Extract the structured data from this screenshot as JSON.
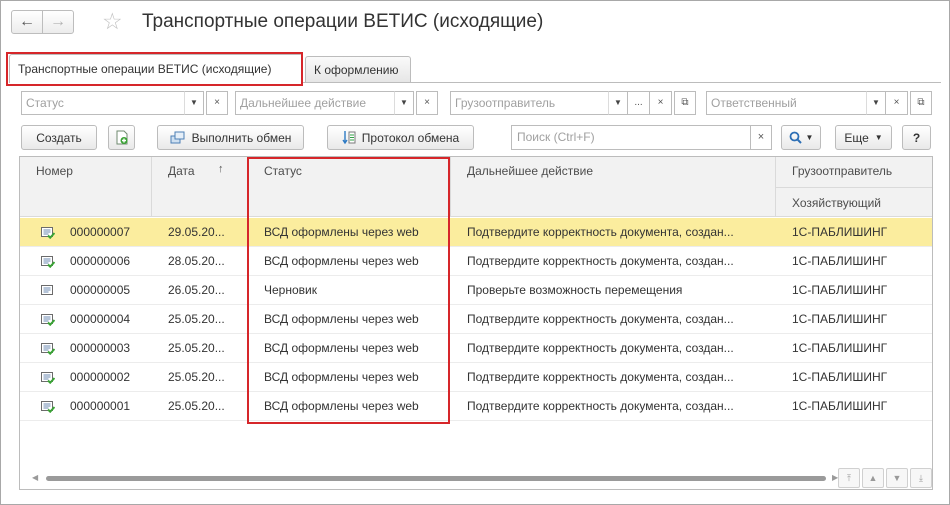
{
  "window": {
    "title": "Транспортные операции ВЕТИС (исходящие)",
    "back_icon": "arrow-left-icon",
    "forward_icon": "arrow-right-icon",
    "favorite_icon": "star-icon"
  },
  "tabs": [
    {
      "label": "Транспортные операции ВЕТИС (исходящие)",
      "active": true
    },
    {
      "label": "К оформлению",
      "active": false
    }
  ],
  "filters": {
    "status": {
      "placeholder": "Статус"
    },
    "next_action": {
      "placeholder": "Дальнейшее действие"
    },
    "shipper": {
      "placeholder": "Грузоотправитель"
    },
    "responsible": {
      "placeholder": "Ответственный"
    },
    "clear_glyph": "×",
    "dropdown_glyph": "▼",
    "select_glyph": "..."
  },
  "toolbar": {
    "create_label": "Создать",
    "exchange_label": "Выполнить обмен",
    "protocol_label": "Протокол обмена",
    "search_placeholder": "Поиск (Ctrl+F)",
    "more_label": "Еще",
    "help_label": "?"
  },
  "table": {
    "columns": {
      "number": "Номер",
      "date": "Дата",
      "status": "Статус",
      "next_action": "Дальнейшее действие",
      "shipper": "Грузоотправитель",
      "entity": "Хозяйствующий"
    },
    "sort_glyph": "↑",
    "rows": [
      {
        "number": "000000007",
        "date": "29.05.20...",
        "status": "ВСД оформлены через web",
        "next_action": "Подтвердите корректность документа, создан...",
        "shipper": "1С-ПАБЛИШИНГ",
        "icon": "document-posted-icon",
        "selected": true
      },
      {
        "number": "000000006",
        "date": "28.05.20...",
        "status": "ВСД оформлены через web",
        "next_action": "Подтвердите корректность документа, создан...",
        "shipper": "1С-ПАБЛИШИНГ",
        "icon": "document-posted-icon",
        "selected": false
      },
      {
        "number": "000000005",
        "date": "26.05.20...",
        "status": "Черновик",
        "next_action": "Проверьте возможность перемещения",
        "shipper": "1С-ПАБЛИШИНГ",
        "icon": "document-draft-icon",
        "selected": false
      },
      {
        "number": "000000004",
        "date": "25.05.20...",
        "status": "ВСД оформлены через web",
        "next_action": "Подтвердите корректность документа, создан...",
        "shipper": "1С-ПАБЛИШИНГ",
        "icon": "document-posted-icon",
        "selected": false
      },
      {
        "number": "000000003",
        "date": "25.05.20...",
        "status": "ВСД оформлены через web",
        "next_action": "Подтвердите корректность документа, создан...",
        "shipper": "1С-ПАБЛИШИНГ",
        "icon": "document-posted-icon",
        "selected": false
      },
      {
        "number": "000000002",
        "date": "25.05.20...",
        "status": "ВСД оформлены через web",
        "next_action": "Подтвердите корректность документа, создан...",
        "shipper": "1С-ПАБЛИШИНГ",
        "icon": "document-posted-icon",
        "selected": false
      },
      {
        "number": "000000001",
        "date": "25.05.20...",
        "status": "ВСД оформлены через web",
        "next_action": "Подтвердите корректность документа, создан...",
        "shipper": "1С-ПАБЛИШИНГ",
        "icon": "document-posted-icon",
        "selected": false
      }
    ]
  },
  "colors": {
    "selected_row": "#fbed9e",
    "highlight_box": "#d6262a",
    "posted_icon_check": "#3aa335"
  }
}
